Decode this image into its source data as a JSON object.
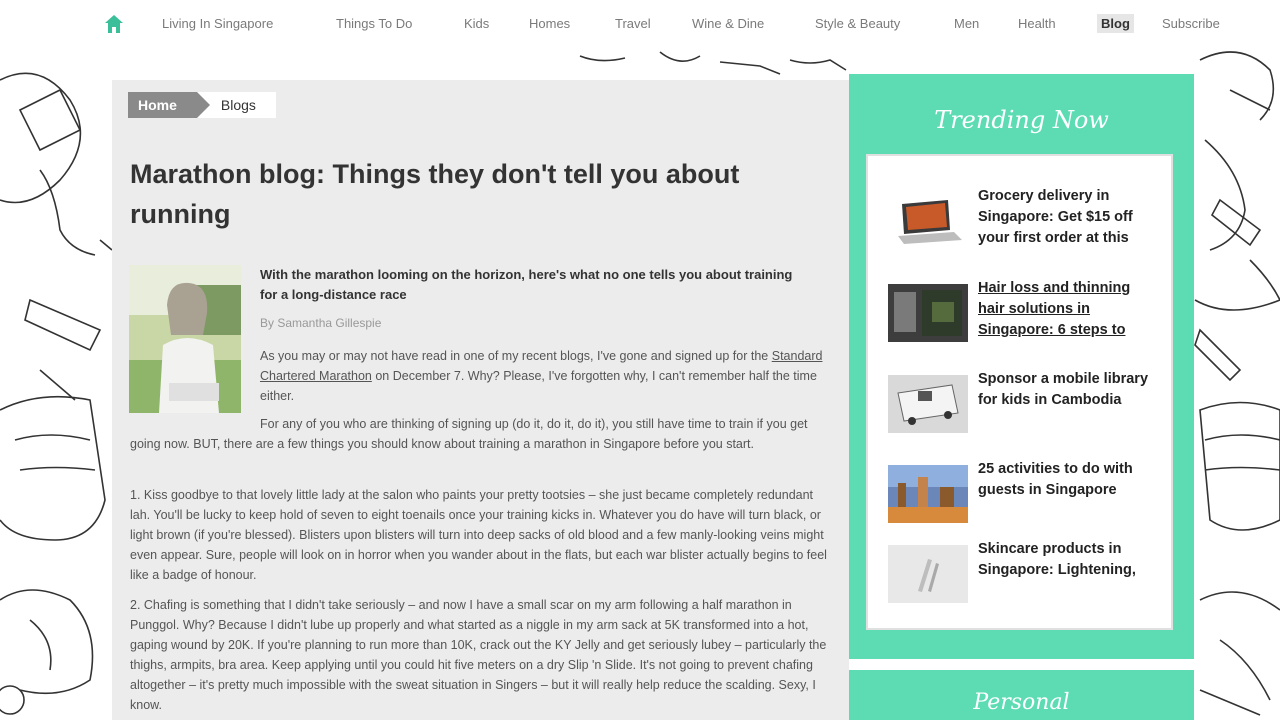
{
  "nav": {
    "items": [
      {
        "label": "Living In Singapore"
      },
      {
        "label": "Things To Do"
      },
      {
        "label": "Kids"
      },
      {
        "label": "Homes"
      },
      {
        "label": "Travel"
      },
      {
        "label": "Wine & Dine"
      },
      {
        "label": "Style & Beauty"
      },
      {
        "label": "Men"
      },
      {
        "label": "Health"
      },
      {
        "label": "Blog",
        "active": true
      },
      {
        "label": "Subscribe"
      }
    ]
  },
  "breadcrumb": {
    "home": "Home",
    "current": "Blogs"
  },
  "article": {
    "title": "Marathon blog: Things they don't tell you about running",
    "lede": "With the marathon looming on the horizon, here's what no one tells you about training for a long-distance race",
    "byline": "By Samantha Gillespie",
    "p1_text": "As you may or may not have read in one of my recent blogs, I've gone and signed up for the",
    "p1_link": "Standard Chartered Marathon",
    "p1_rest": "on December 7. Why? Please, I've forgotten why, I can't remember half the time either.",
    "p2": "For any of you who are thinking of signing up (do it, do it, do it), you still have time to train if you get going now. BUT, there are a few things you should know about training a marathon in Singapore before you start.",
    "p3": "1. Kiss goodbye to that lovely little lady at the salon who paints your pretty tootsies – she just became completely redundant lah. You'll be lucky to keep hold of seven to eight toenails once your training kicks in. Whatever you do have will turn black, or light brown (if you're blessed). Blisters upon blisters will turn into deep sacks of old blood and a few manly-looking veins might even appear. Sure, people will look on in horror when you wander about in the flats, but each war blister actually begins to feel like a badge of honour.",
    "p4": "2. Chafing is something that I didn't take seriously – and now I have a small scar on my arm following a half marathon in Punggol. Why? Because I didn't lube up properly and what started as a niggle in my arm sack at 5K transformed into a hot, gaping wound by 20K. If you're planning to run more than 10K, crack out the KY Jelly and get seriously lubey – particularly the thighs, armpits, bra area. Keep applying until you could hit five meters on a dry Slip 'n Slide. It's not going to prevent chafing altogether – it's pretty much impossible with the sweat situation in Singers – but it will really help reduce the scalding. Sexy, I know."
  },
  "sidebar": {
    "heading": "Trending Now",
    "items": [
      {
        "title": "Grocery delivery in Singapore: Get $15 off your first order at this",
        "thumb": "laptop-thumb"
      },
      {
        "title": "Hair loss and thinning hair solutions in Singapore: 6 steps to",
        "thumb": "clinic-thumb",
        "underlined": true
      },
      {
        "title": "Sponsor a mobile library for kids in Cambodia",
        "thumb": "bus-thumb"
      },
      {
        "title": "25 activities to do with guests in Singapore",
        "thumb": "city-thumb"
      },
      {
        "title": "Skincare products in Singapore: Lightening,",
        "thumb": "skincare-thumb"
      }
    ],
    "heading2": "Personal"
  },
  "colors": {
    "accent": "#5ddcb4",
    "nav_home_icon": "#3bbf9a",
    "content_bg": "#ececec"
  }
}
